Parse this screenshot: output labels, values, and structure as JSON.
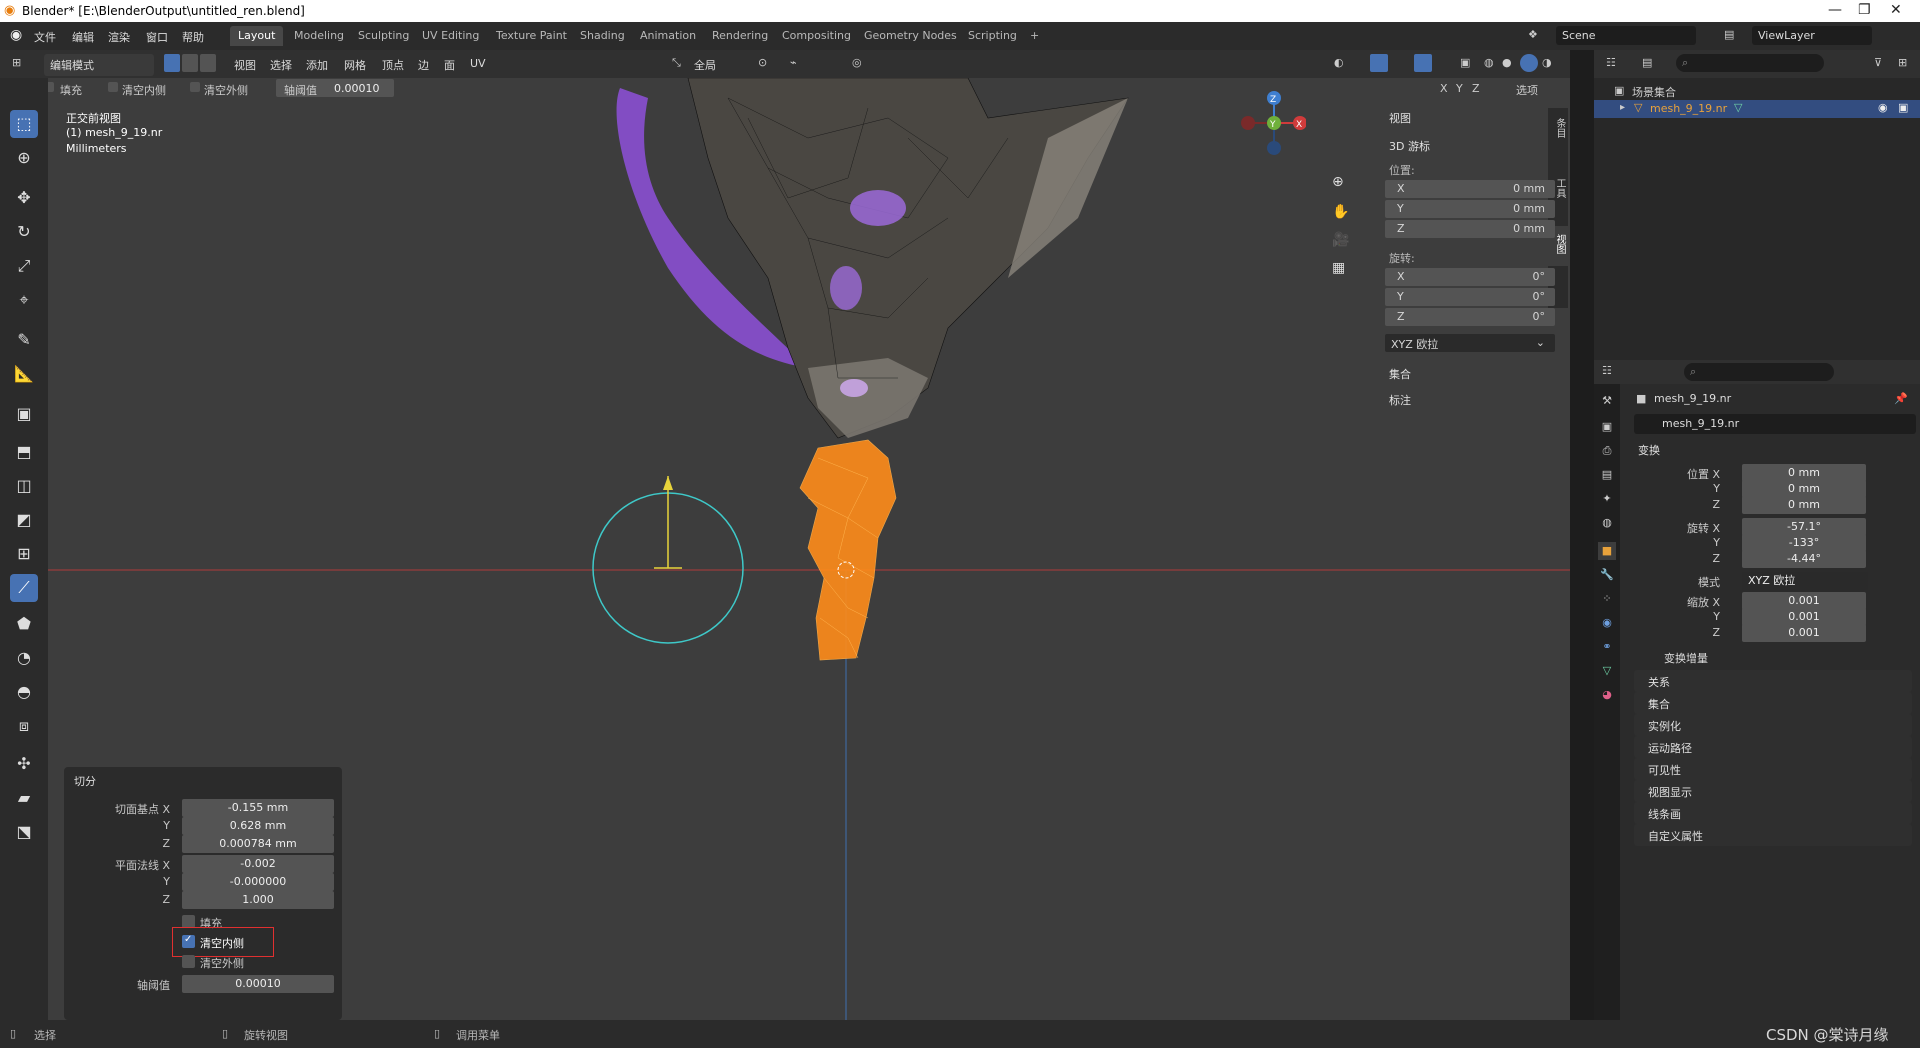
{
  "titlebar": {
    "title": "Blender* [E:\\BlenderOutput\\untitled_ren.blend]"
  },
  "menu": [
    "文件",
    "编辑",
    "渲染",
    "窗口",
    "帮助"
  ],
  "workspaces": [
    {
      "label": "Layout",
      "active": true
    },
    {
      "label": "Modeling"
    },
    {
      "label": "Sculpting"
    },
    {
      "label": "UV Editing"
    },
    {
      "label": "Texture Paint"
    },
    {
      "label": "Shading"
    },
    {
      "label": "Animation"
    },
    {
      "label": "Rendering"
    },
    {
      "label": "Compositing"
    },
    {
      "label": "Geometry Nodes"
    },
    {
      "label": "Scripting"
    },
    {
      "label": "+"
    }
  ],
  "scene": {
    "name": "Scene",
    "view_layer": "ViewLayer"
  },
  "header": {
    "mode": "编辑模式",
    "menus": [
      "视图",
      "选择",
      "添加",
      "网格",
      "顶点",
      "边",
      "面",
      "UV"
    ],
    "transform_orientation": "全局",
    "axes": [
      "X",
      "Y",
      "Z"
    ],
    "options": "选项"
  },
  "tool_settings": {
    "fill": "填充",
    "clear_inner": "清空内侧",
    "clear_outer": "清空外侧",
    "threshold_label": "轴阈值",
    "threshold_value": "0.00010"
  },
  "viewport": {
    "view_name": "正交前视图",
    "object_name": "(1) mesh_9_19.nr",
    "units": "Millimeters"
  },
  "gizmo": {
    "x": "X",
    "y": "Y",
    "z": "Z"
  },
  "npanel": {
    "tabs": [
      "条目",
      "工具",
      "视图"
    ],
    "view": "视图",
    "cursor": "3D 游标",
    "location": "位置:",
    "loc": [
      {
        "axis": "X",
        "value": "0 mm"
      },
      {
        "axis": "Y",
        "value": "0 mm"
      },
      {
        "axis": "Z",
        "value": "0 mm"
      }
    ],
    "rotation": "旋转:",
    "rot": [
      {
        "axis": "X",
        "value": "0°"
      },
      {
        "axis": "Y",
        "value": "0°"
      },
      {
        "axis": "Z",
        "value": "0°"
      }
    ],
    "rot_mode": "XYZ 欧拉",
    "collection": "集合",
    "annotation": "标注"
  },
  "operator": {
    "title": "切分",
    "plane_co_label": "切面基点 X",
    "plane_co": [
      "-0.155 mm",
      "0.628 mm",
      "0.000784 mm"
    ],
    "plane_no_label": "平面法线 X",
    "plane_no": [
      "-0.002",
      "-0.000000",
      "1.000"
    ],
    "axis_y": "Y",
    "axis_z": "Z",
    "fill": "填充",
    "clear_inner": "清空内侧",
    "clear_outer": "清空外侧",
    "threshold_label": "轴阈值",
    "threshold": "0.00010"
  },
  "outliner": {
    "collection": "场景集合",
    "object": "mesh_9_19.nr"
  },
  "properties": {
    "object_name": "mesh_9_19.nr",
    "object_data": "mesh_9_19.nr",
    "transform": "变换",
    "location_label": "位置 X",
    "location": [
      "0 mm",
      "0 mm",
      "0 mm"
    ],
    "rotation_label": "旋转 X",
    "rotation": [
      "-57.1°",
      "-133°",
      "-4.44°"
    ],
    "mode_label": "模式",
    "mode": "XYZ 欧拉",
    "scale_label": "缩放 X",
    "scale": [
      "0.001",
      "0.001",
      "0.001"
    ],
    "axis_y": "Y",
    "axis_z": "Z",
    "delta": "变换增量",
    "sections": [
      "关系",
      "集合",
      "实例化",
      "运动路径",
      "可见性",
      "视图显示",
      "线条画",
      "自定义属性"
    ]
  },
  "status": {
    "select": "选择",
    "rotate": "旋转视图",
    "menu": "调用菜单",
    "watermark": "CSDN @棠诗月缘"
  },
  "colors": {
    "accent": "#4772b3",
    "highlight_box": "#e03030",
    "selected_mesh": "#ff8c1a",
    "purple_mesh": "#8a4fd1"
  }
}
